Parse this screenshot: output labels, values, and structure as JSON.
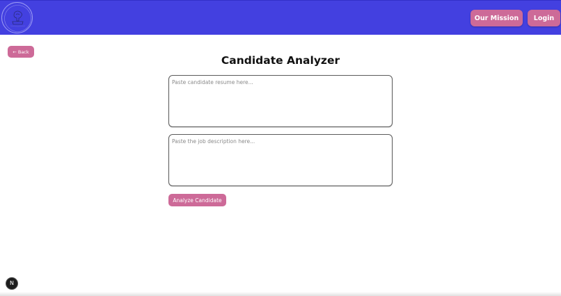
{
  "header": {
    "logo_icon": "brain-logo-icon",
    "nav": {
      "mission_label": "Our Mission",
      "login_label": "Login"
    }
  },
  "back_label": "← Back",
  "main": {
    "title": "Candidate Analyzer",
    "resume_input": {
      "value": "",
      "placeholder": "Paste candidate resume here..."
    },
    "job_input": {
      "value": "",
      "placeholder": "Paste the job description here..."
    },
    "analyze_label": "Analyze Candidate"
  },
  "dev_badge": {
    "label": "N",
    "icon": "nextjs-icon"
  },
  "colors": {
    "header_bg": "#4340e0",
    "accent": "#cd6a98",
    "text": "#111111"
  }
}
